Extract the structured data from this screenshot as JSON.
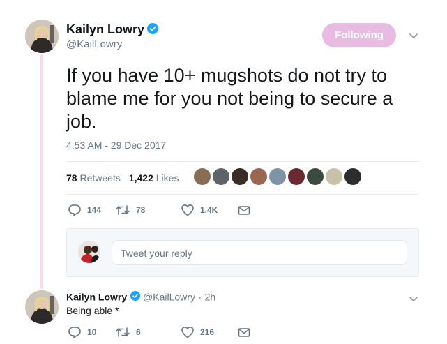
{
  "author": {
    "name": "Kailyn Lowry",
    "handle": "@KailLowry",
    "verified": true
  },
  "follow_button": {
    "label": "Following",
    "color": "#e8bbe2"
  },
  "tweet": {
    "text": "If you have 10+ mugshots do not try to blame me for you not being to secure a job.",
    "timestamp": "4:53 AM - 29 Dec 2017"
  },
  "stats": {
    "retweets_count": "78",
    "retweets_label": "Retweets",
    "likes_count": "1,422",
    "likes_label": "Likes"
  },
  "actions": {
    "replies": "144",
    "retweets": "78",
    "likes": "1.4K"
  },
  "reply_composer": {
    "placeholder": "Tweet your reply"
  },
  "reply": {
    "name": "Kailyn Lowry",
    "handle": "@KailLowry",
    "separator": "·",
    "time": "2h",
    "text": "Being able *",
    "replies": "10",
    "retweets": "6",
    "likes": "216"
  },
  "colors": {
    "accent_blue": "#1da1f2",
    "thread_line": "#f6dbe9",
    "muted": "#657786"
  },
  "icons": [
    "chevron-down-icon",
    "verified-icon",
    "reply-icon",
    "retweet-icon",
    "like-icon",
    "dm-icon"
  ]
}
